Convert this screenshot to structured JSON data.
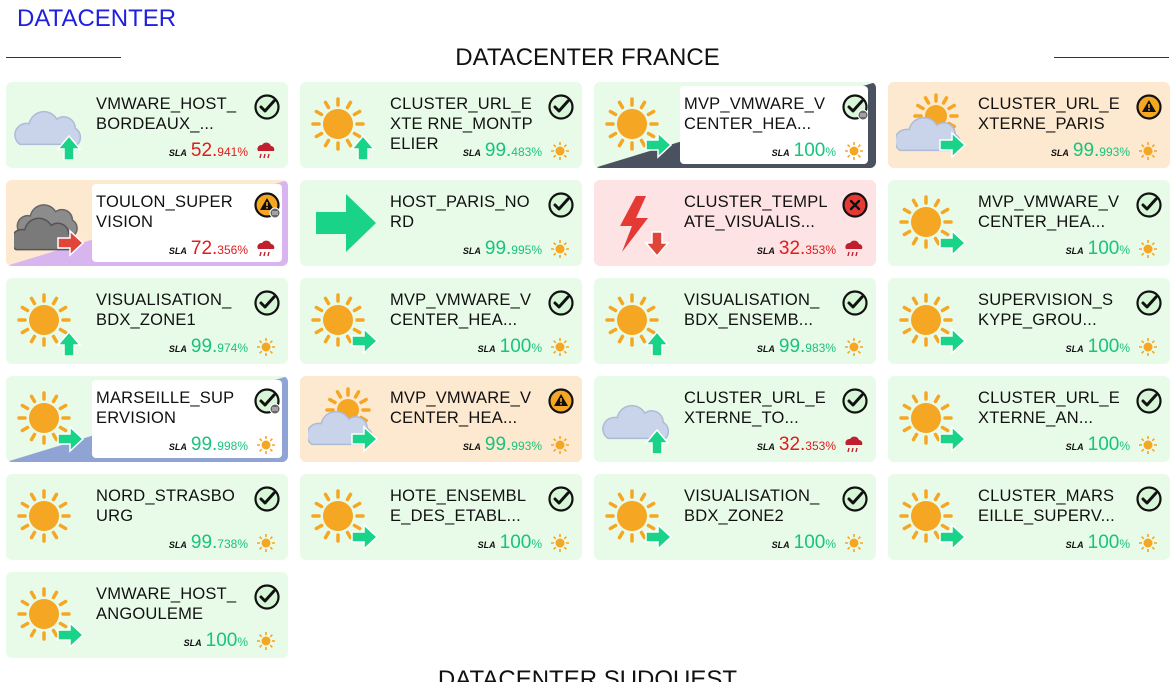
{
  "page_title": "DATACENTER",
  "section1_title": "DATACENTER FRANCE",
  "section2_title": "DATACENTER SUDOUEST",
  "sla_label": "SLA",
  "tiles": [
    {
      "name": "VMWARE_HOST_ BORDEAUX_...",
      "sla_int": "52.",
      "sla_dec": "941%",
      "sla_state": "bad",
      "weather": "cloud",
      "trend": "up-green",
      "status": "ok",
      "mini": "storm",
      "bg": "green",
      "wedge": ""
    },
    {
      "name": "CLUSTER_URL_EXTE RNE_MONTPELIER",
      "sla_int": "99.",
      "sla_dec": "483%",
      "sla_state": "good",
      "weather": "sun",
      "trend": "up-green",
      "status": "ok",
      "mini": "sun",
      "bg": "green",
      "wedge": ""
    },
    {
      "name": "MVP_VMWARE_V CENTER_HEA...",
      "sla_int": "100",
      "sla_dec": "%",
      "sla_state": "good",
      "weather": "sun",
      "trend": "right-green",
      "status": "ok-ack",
      "mini": "sun",
      "bg": "green",
      "wedge": "dark"
    },
    {
      "name": "CLUSTER_URL_E XTERNE_PARIS",
      "sla_int": "99.",
      "sla_dec": "993%",
      "sla_state": "good",
      "weather": "partly",
      "trend": "right-green",
      "status": "warn",
      "mini": "sun",
      "bg": "orange",
      "wedge": ""
    },
    {
      "name": "TOULON_SUPER VISION",
      "sla_int": "72.",
      "sla_dec": "356%",
      "sla_state": "bad",
      "weather": "darkcloud",
      "trend": "right-red",
      "status": "warn-ack",
      "mini": "storm",
      "bg": "orange",
      "wedge": "purple"
    },
    {
      "name": "HOST_PARIS_NO RD",
      "sla_int": "99.",
      "sla_dec": "995%",
      "sla_state": "good",
      "weather": "bigarrow",
      "trend": "",
      "status": "ok",
      "mini": "sun",
      "bg": "green",
      "wedge": ""
    },
    {
      "name": "CLUSTER_TEMPL ATE_VISUALIS...",
      "sla_int": "32.",
      "sla_dec": "353%",
      "sla_state": "bad",
      "weather": "bolt",
      "trend": "down-red",
      "status": "crit",
      "mini": "storm",
      "bg": "red",
      "wedge": ""
    },
    {
      "name": "MVP_VMWARE_V CENTER_HEA...",
      "sla_int": "100",
      "sla_dec": "%",
      "sla_state": "good",
      "weather": "sun",
      "trend": "right-green",
      "status": "ok",
      "mini": "sun",
      "bg": "green",
      "wedge": ""
    },
    {
      "name": "VISUALISATION_ BDX_ZONE1",
      "sla_int": "99.",
      "sla_dec": "974%",
      "sla_state": "good",
      "weather": "sun",
      "trend": "up-green",
      "status": "ok",
      "mini": "sun",
      "bg": "green",
      "wedge": ""
    },
    {
      "name": "MVP_VMWARE_V CENTER_HEA...",
      "sla_int": "100",
      "sla_dec": "%",
      "sla_state": "good",
      "weather": "sun",
      "trend": "right-green",
      "status": "ok",
      "mini": "sun",
      "bg": "green",
      "wedge": ""
    },
    {
      "name": "VISUALISATION_ BDX_ENSEMB...",
      "sla_int": "99.",
      "sla_dec": "983%",
      "sla_state": "good",
      "weather": "sun",
      "trend": "up-green",
      "status": "ok",
      "mini": "sun",
      "bg": "green",
      "wedge": ""
    },
    {
      "name": "SUPERVISION_S KYPE_GROU...",
      "sla_int": "100",
      "sla_dec": "%",
      "sla_state": "good",
      "weather": "sun",
      "trend": "right-green",
      "status": "ok",
      "mini": "sun",
      "bg": "green",
      "wedge": ""
    },
    {
      "name": "MARSEILLE_SUP ERVISION",
      "sla_int": "99.",
      "sla_dec": "998%",
      "sla_state": "good",
      "weather": "sun",
      "trend": "right-green",
      "status": "ok-ack",
      "mini": "sun",
      "bg": "green",
      "wedge": "blue"
    },
    {
      "name": "MVP_VMWARE_V CENTER_HEA...",
      "sla_int": "99.",
      "sla_dec": "993%",
      "sla_state": "good",
      "weather": "partly",
      "trend": "right-green",
      "status": "warn",
      "mini": "sun",
      "bg": "orange",
      "wedge": ""
    },
    {
      "name": "CLUSTER_URL_E XTERNE_TO...",
      "sla_int": "32.",
      "sla_dec": "353%",
      "sla_state": "bad",
      "weather": "cloud",
      "trend": "up-green",
      "status": "ok",
      "mini": "storm",
      "bg": "green",
      "wedge": ""
    },
    {
      "name": "CLUSTER_URL_E XTERNE_AN...",
      "sla_int": "100",
      "sla_dec": "%",
      "sla_state": "good",
      "weather": "sun",
      "trend": "right-green",
      "status": "ok",
      "mini": "sun",
      "bg": "green",
      "wedge": ""
    },
    {
      "name": "NORD_STRASBO URG",
      "sla_int": "99.",
      "sla_dec": "738%",
      "sla_state": "good",
      "weather": "sun",
      "trend": "",
      "status": "ok",
      "mini": "sun",
      "bg": "green",
      "wedge": ""
    },
    {
      "name": "HOTE_ENSEMBL E_DES_ETABL...",
      "sla_int": "100",
      "sla_dec": "%",
      "sla_state": "good",
      "weather": "sun",
      "trend": "right-green",
      "status": "ok",
      "mini": "sun",
      "bg": "green",
      "wedge": ""
    },
    {
      "name": "VISUALISATION_ BDX_ZONE2",
      "sla_int": "100",
      "sla_dec": "%",
      "sla_state": "good",
      "weather": "sun",
      "trend": "right-green",
      "status": "ok",
      "mini": "sun",
      "bg": "green",
      "wedge": ""
    },
    {
      "name": "CLUSTER_MARS EILLE_SUPERV...",
      "sla_int": "100",
      "sla_dec": "%",
      "sla_state": "good",
      "weather": "sun",
      "trend": "right-green",
      "status": "ok",
      "mini": "sun",
      "bg": "green",
      "wedge": ""
    },
    {
      "name": "VMWARE_HOST_ ANGOULEME",
      "sla_int": "100",
      "sla_dec": "%",
      "sla_state": "good",
      "weather": "sun",
      "trend": "right-green",
      "status": "ok",
      "mini": "sun",
      "bg": "green",
      "wedge": ""
    }
  ],
  "colors": {
    "title": "#1f1fe0",
    "good": "#19c37d",
    "bad": "#e01b1b",
    "sun": "#f5a623",
    "arrow_green": "#19d388"
  }
}
